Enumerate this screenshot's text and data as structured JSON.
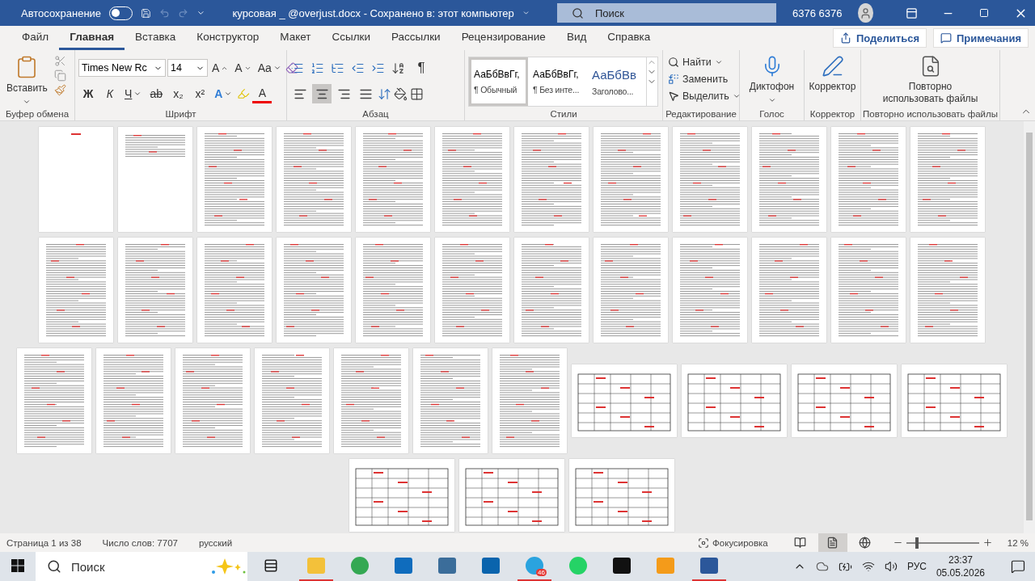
{
  "title_bar": {
    "autosave_label": "Автосохранение",
    "autosave_on": false,
    "document_title": "курсовая _ @overjust.docx  -  Сохранено в: этот компьютер",
    "search_placeholder": "Поиск",
    "user_name": "6376 6376"
  },
  "tabs": [
    {
      "label": "Файл",
      "selected": false
    },
    {
      "label": "Главная",
      "selected": true
    },
    {
      "label": "Вставка",
      "selected": false
    },
    {
      "label": "Конструктор",
      "selected": false
    },
    {
      "label": "Макет",
      "selected": false
    },
    {
      "label": "Ссылки",
      "selected": false
    },
    {
      "label": "Рассылки",
      "selected": false
    },
    {
      "label": "Рецензирование",
      "selected": false
    },
    {
      "label": "Вид",
      "selected": false
    },
    {
      "label": "Справка",
      "selected": false
    }
  ],
  "share_button": "Поделиться",
  "comments_button": "Примечания",
  "ribbon": {
    "clipboard": {
      "paste": "Вставить",
      "label": "Буфер обмена"
    },
    "font": {
      "family": "Times New Rc",
      "size": "14",
      "grow": "A",
      "shrink": "A",
      "change_case": "Aa",
      "bold": "Ж",
      "italic": "К",
      "underline": "Ч",
      "strike": "ab",
      "subscript": "x₂",
      "superscript": "x²",
      "effects": "A",
      "font_color": "A",
      "label": "Шрифт"
    },
    "paragraph": {
      "align": [
        {
          "kind": "left",
          "selected": false
        },
        {
          "kind": "center",
          "selected": true
        },
        {
          "kind": "right",
          "selected": false
        },
        {
          "kind": "justify",
          "selected": false
        }
      ],
      "show_marks": "¶",
      "label": "Абзац"
    },
    "styles": {
      "items": [
        {
          "preview": "АаБбВвГг,",
          "name": "¶ Обычный",
          "kind": "body",
          "selected": true
        },
        {
          "preview": "АаБбВвГг,",
          "name": "¶ Без инте...",
          "kind": "body",
          "selected": false
        },
        {
          "preview": "АаБбВв",
          "name": "Заголово...",
          "kind": "heading",
          "selected": false
        }
      ],
      "label": "Стили"
    },
    "editing": {
      "find": "Найти",
      "replace": "Заменить",
      "select": "Выделить",
      "label": "Редактирование"
    },
    "voice": {
      "dictate": "Диктофон",
      "label": "Голос"
    },
    "editor": {
      "button": "Корректор",
      "label": "Корректор"
    },
    "reuse": {
      "button": "Повторно использовать файлы",
      "label": "Повторно использовать файлы"
    }
  },
  "pages": [
    {
      "row": [
        {
          "kind": "cover"
        },
        {
          "kind": "contents"
        },
        {
          "kind": "text"
        },
        {
          "kind": "text"
        },
        {
          "kind": "text"
        },
        {
          "kind": "text"
        },
        {
          "kind": "text"
        },
        {
          "kind": "text"
        },
        {
          "kind": "text"
        },
        {
          "kind": "text"
        },
        {
          "kind": "text"
        },
        {
          "kind": "text"
        }
      ]
    },
    {
      "row": [
        {
          "kind": "text"
        },
        {
          "kind": "text"
        },
        {
          "kind": "text"
        },
        {
          "kind": "text"
        },
        {
          "kind": "text"
        },
        {
          "kind": "text"
        },
        {
          "kind": "text"
        },
        {
          "kind": "text"
        },
        {
          "kind": "text"
        },
        {
          "kind": "text"
        },
        {
          "kind": "text"
        },
        {
          "kind": "text"
        }
      ]
    },
    {
      "row": [
        {
          "kind": "text"
        },
        {
          "kind": "text"
        },
        {
          "kind": "text"
        },
        {
          "kind": "references"
        },
        {
          "kind": "references"
        },
        {
          "kind": "references"
        },
        {
          "kind": "references"
        },
        {
          "kind": "table"
        },
        {
          "kind": "table"
        },
        {
          "kind": "table"
        },
        {
          "kind": "table"
        }
      ]
    },
    {
      "row": [
        {
          "kind": "table"
        },
        {
          "kind": "table"
        },
        {
          "kind": "table"
        }
      ]
    }
  ],
  "status_bar": {
    "page": "Страница 1 из 38",
    "words": "Число слов: 7707",
    "language": "русский",
    "focus": "Фокусировка",
    "views": [
      {
        "kind": "read",
        "selected": false
      },
      {
        "kind": "print",
        "selected": true
      },
      {
        "kind": "web",
        "selected": false
      }
    ],
    "zoom": {
      "level": 0.13,
      "reading": "12 %"
    }
  },
  "taskbar": {
    "search_placeholder": "Поиск",
    "apps": [
      {
        "kind": "taskview",
        "running": false
      },
      {
        "kind": "explorer",
        "running": true
      },
      {
        "kind": "chrome",
        "running": false
      },
      {
        "kind": "store",
        "running": false
      },
      {
        "kind": "python",
        "running": false
      },
      {
        "kind": "outlook",
        "running": false
      },
      {
        "kind": "telegram",
        "running": true,
        "badge": "46"
      },
      {
        "kind": "whatsapp",
        "running": false
      },
      {
        "kind": "fist",
        "running": false
      },
      {
        "kind": "sublime",
        "running": false
      },
      {
        "kind": "word",
        "running": true
      }
    ],
    "language": "РУС",
    "time": "23:37",
    "date": "05.05.2026"
  }
}
